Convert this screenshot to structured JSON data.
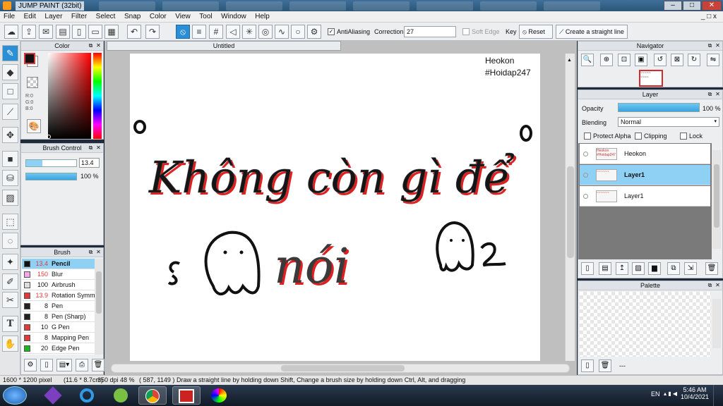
{
  "window": {
    "title": "JUMP PAINT (32bit)",
    "min": "–",
    "max": "□",
    "close": "✕"
  },
  "menu": [
    "File",
    "Edit",
    "Layer",
    "Filter",
    "Select",
    "Snap",
    "Color",
    "View",
    "Tool",
    "Window",
    "Help"
  ],
  "menu_right": "_ □ x",
  "toolbar": {
    "antialiasing_label": "AntiAliasing",
    "antialiasing_checked": true,
    "correction_label": "Correction",
    "correction_value": "27",
    "soft_edge_label": "Soft Edge",
    "key_label": "Key",
    "reset_label": "Reset",
    "straight_line_label": "Create a straight line"
  },
  "color_panel": {
    "title": "Color",
    "r": "R:0",
    "g": "G:0",
    "b": "B:0",
    "foreground": "#111111",
    "background": "#ffffff"
  },
  "brush_control": {
    "title": "Brush Control",
    "size": "13.4",
    "opacity": "100 %",
    "size_fraction": 0.33,
    "opacity_fraction": 1.0
  },
  "brush_panel": {
    "title": "Brush",
    "items": [
      {
        "size": "13.4",
        "name": "Pencil",
        "color": "#111111",
        "size_color": "#e03a3a",
        "selected": true
      },
      {
        "size": "150",
        "name": "Blur",
        "color": "#f4a6e8",
        "size_color": "#e03a3a",
        "selected": false
      },
      {
        "size": "100",
        "name": "Airbrush",
        "color": "#dddddd",
        "size_color": "#111111",
        "selected": false
      },
      {
        "size": "13.9",
        "name": "Rotation Symm",
        "color": "#e03a3a",
        "size_color": "#e03a3a",
        "selected": false
      },
      {
        "size": "8",
        "name": "Pen",
        "color": "#222222",
        "size_color": "#111111",
        "selected": false
      },
      {
        "size": "8",
        "name": "Pen (Sharp)",
        "color": "#222222",
        "size_color": "#111111",
        "selected": false
      },
      {
        "size": "10",
        "name": "G Pen",
        "color": "#e03a3a",
        "size_color": "#111111",
        "selected": false
      },
      {
        "size": "8",
        "name": "Mapping Pen",
        "color": "#e03a3a",
        "size_color": "#111111",
        "selected": false
      },
      {
        "size": "20",
        "name": "Edge Pen",
        "color": "#1fb31f",
        "size_color": "#111111",
        "selected": false
      }
    ]
  },
  "canvas": {
    "tab_title": "Untitled",
    "text_signature_1": "Heokon",
    "text_signature_2": "#Hoidap247",
    "text_main_line_1": "Không còn gì để",
    "text_main_line_2": "nói"
  },
  "navigator": {
    "title": "Navigator"
  },
  "layer_panel": {
    "title": "Layer",
    "opacity_label": "Opacity",
    "opacity_value": "100 %",
    "opacity_fraction": 1.0,
    "blending_label": "Blending",
    "blending_value": "Normal",
    "protect_alpha": "Protect Alpha",
    "clipping": "Clipping",
    "lock": "Lock",
    "layers": [
      {
        "name": "Heokon",
        "selected": false,
        "bold": false,
        "thumb_text": "Heokon #Hoidap247"
      },
      {
        "name": "Layer1",
        "selected": true,
        "bold": true,
        "thumb_text": "~~~~~~"
      },
      {
        "name": "Layer1",
        "selected": false,
        "bold": false,
        "thumb_text": "~~~~~~"
      }
    ]
  },
  "palette": {
    "title": "Palette",
    "extra": "---"
  },
  "status": {
    "size": "1600 * 1200 pixel",
    "cm": "(11.6 * 8.7cm)",
    "dpi": "350 dpi",
    "zoom": "48 %",
    "coords": "( 587, 1149 )",
    "hint": "Draw a straight line by holding down Shift, Change a brush size by holding down Ctrl, Alt, and dragging"
  },
  "taskbar": {
    "lang": "EN",
    "time": "5:46 AM",
    "date": "10/4/2021"
  },
  "colors": {
    "accent": "#2b8fd6",
    "selected_row": "#8fd0f5"
  }
}
